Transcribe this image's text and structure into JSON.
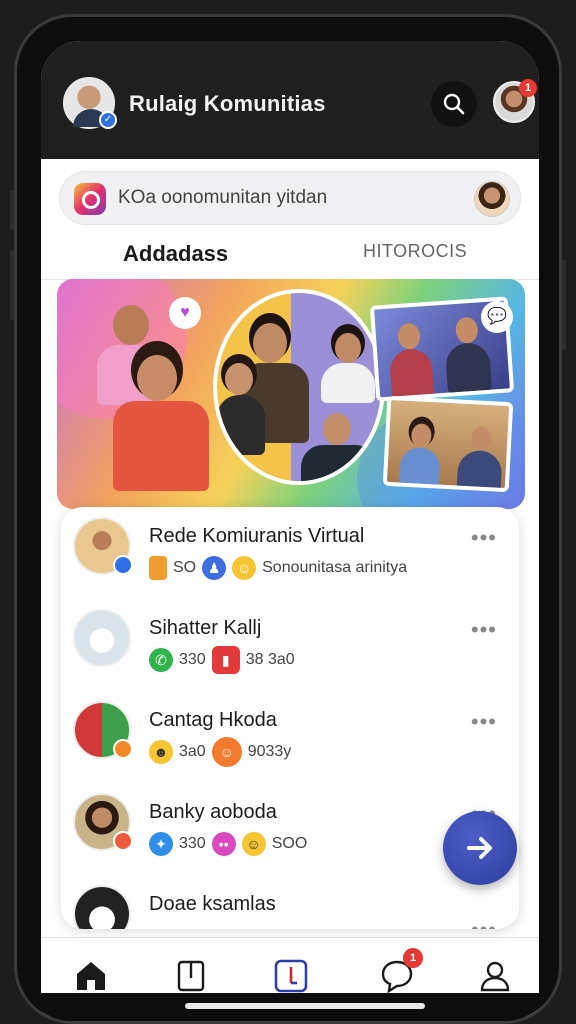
{
  "header": {
    "title": "Rulaig Komunitias"
  },
  "search": {
    "text": "KOa oonomunitan yitdan"
  },
  "tabs": [
    {
      "label": "Addadass"
    },
    {
      "label": "HITOROCIS"
    }
  ],
  "rooms": [
    {
      "title": "Rede Komiuranis Virtual",
      "count": "SO",
      "subtitle": "Sonounitasa arinitya"
    },
    {
      "title": "Sihatter Kallj",
      "count": "330",
      "count2": "38 3a0"
    },
    {
      "title": "Cantag Hkoda",
      "count": "3a0",
      "count2": "9033y"
    },
    {
      "title": "Banky aoboda",
      "count": "330",
      "count2": "SOO"
    },
    {
      "title": "Doae ksamlas"
    }
  ],
  "nav": {
    "messages_badge": "1",
    "profile_badge": "1"
  },
  "colors": {
    "accent": "#2f3fa8",
    "badge_red": "#e53935",
    "verify_blue": "#2f6fe8"
  }
}
